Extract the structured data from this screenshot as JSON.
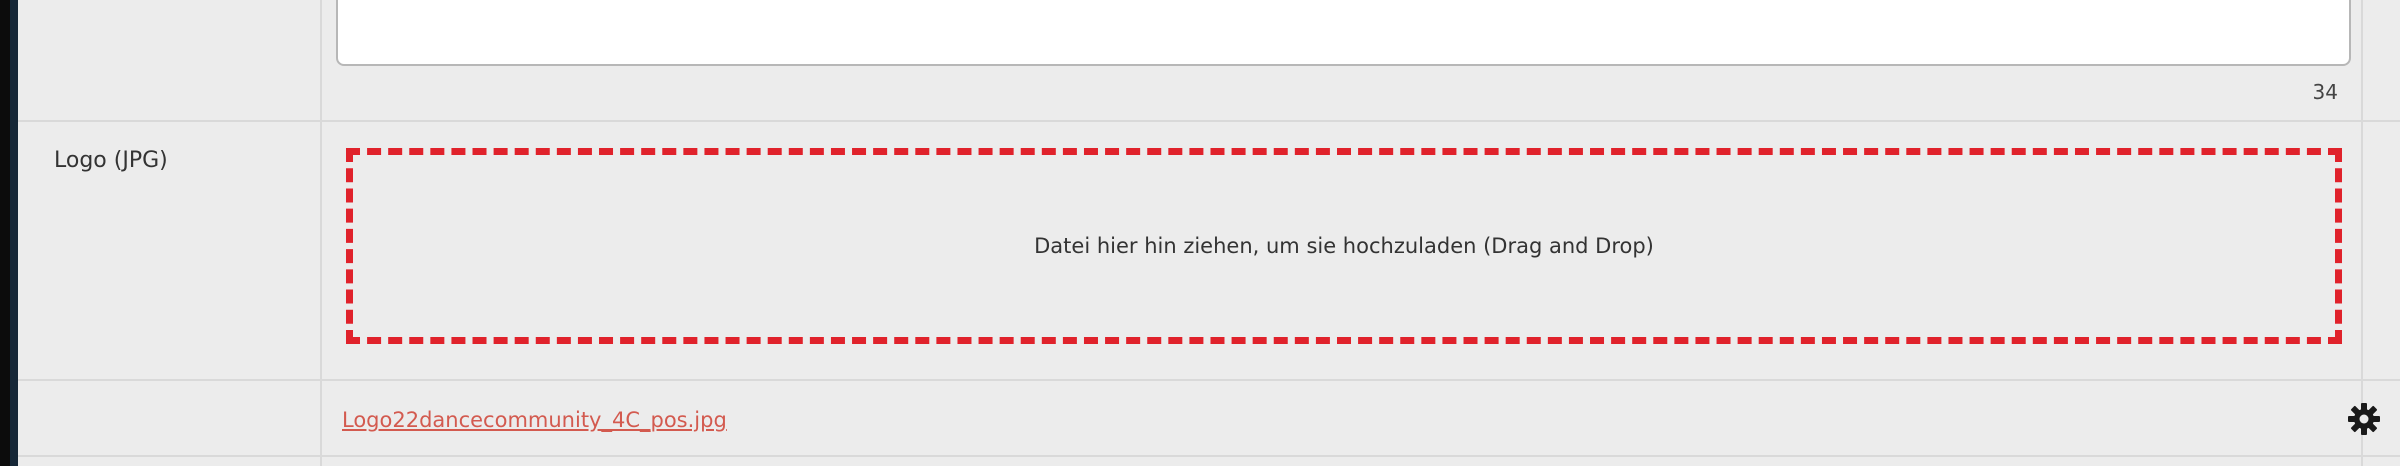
{
  "textarea_row": {
    "char_count": "34"
  },
  "logo_row": {
    "label": "Logo (JPG)",
    "dropzone_text": "Datei hier hin ziehen, um sie hochzuladen (Drag and Drop)",
    "dropzone_border_color": "#e0222b"
  },
  "file_row": {
    "file_name": "Logo22dancecommunity_4C_pos.jpg",
    "file_link_color": "#d35a4f",
    "action_icon": "gear-icon"
  }
}
